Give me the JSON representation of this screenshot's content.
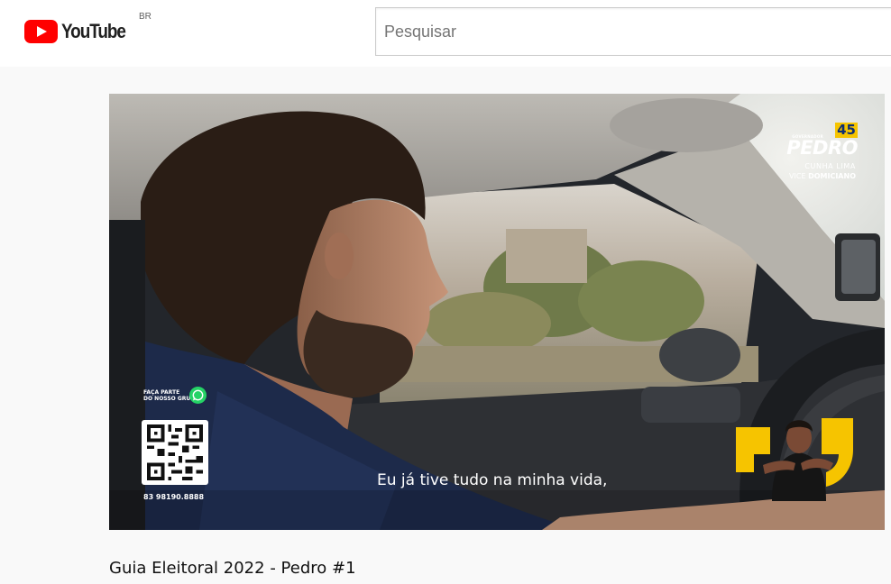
{
  "header": {
    "logo_text": "YouTube",
    "region_code": "BR",
    "search_placeholder": "Pesquisar"
  },
  "video": {
    "title": "Guia Eleitoral 2022 - Pedro #1",
    "subtitle": "Eu já tive tudo na minha vida,",
    "campaign": {
      "role": "GOVERNADOR",
      "number": "45",
      "name": "PEDRO",
      "surname": "CUNHA LIMA",
      "vice_prefix": "VICE",
      "vice_name": "DOMICIANO"
    },
    "group_invite": {
      "line1": "FAÇA PARTE",
      "line2": "DO NOSSO GRUPO",
      "phone": "83 98190.8888"
    },
    "interpreter_number": "45"
  },
  "colors": {
    "youtube_red": "#ff0000",
    "campaign_yellow": "#f6c400",
    "campaign_blue": "#0e2e73",
    "whatsapp_green": "#25d366"
  },
  "icons": [
    "youtube-logo-icon",
    "play-triangle-icon",
    "whatsapp-icon",
    "qr-code-icon"
  ]
}
